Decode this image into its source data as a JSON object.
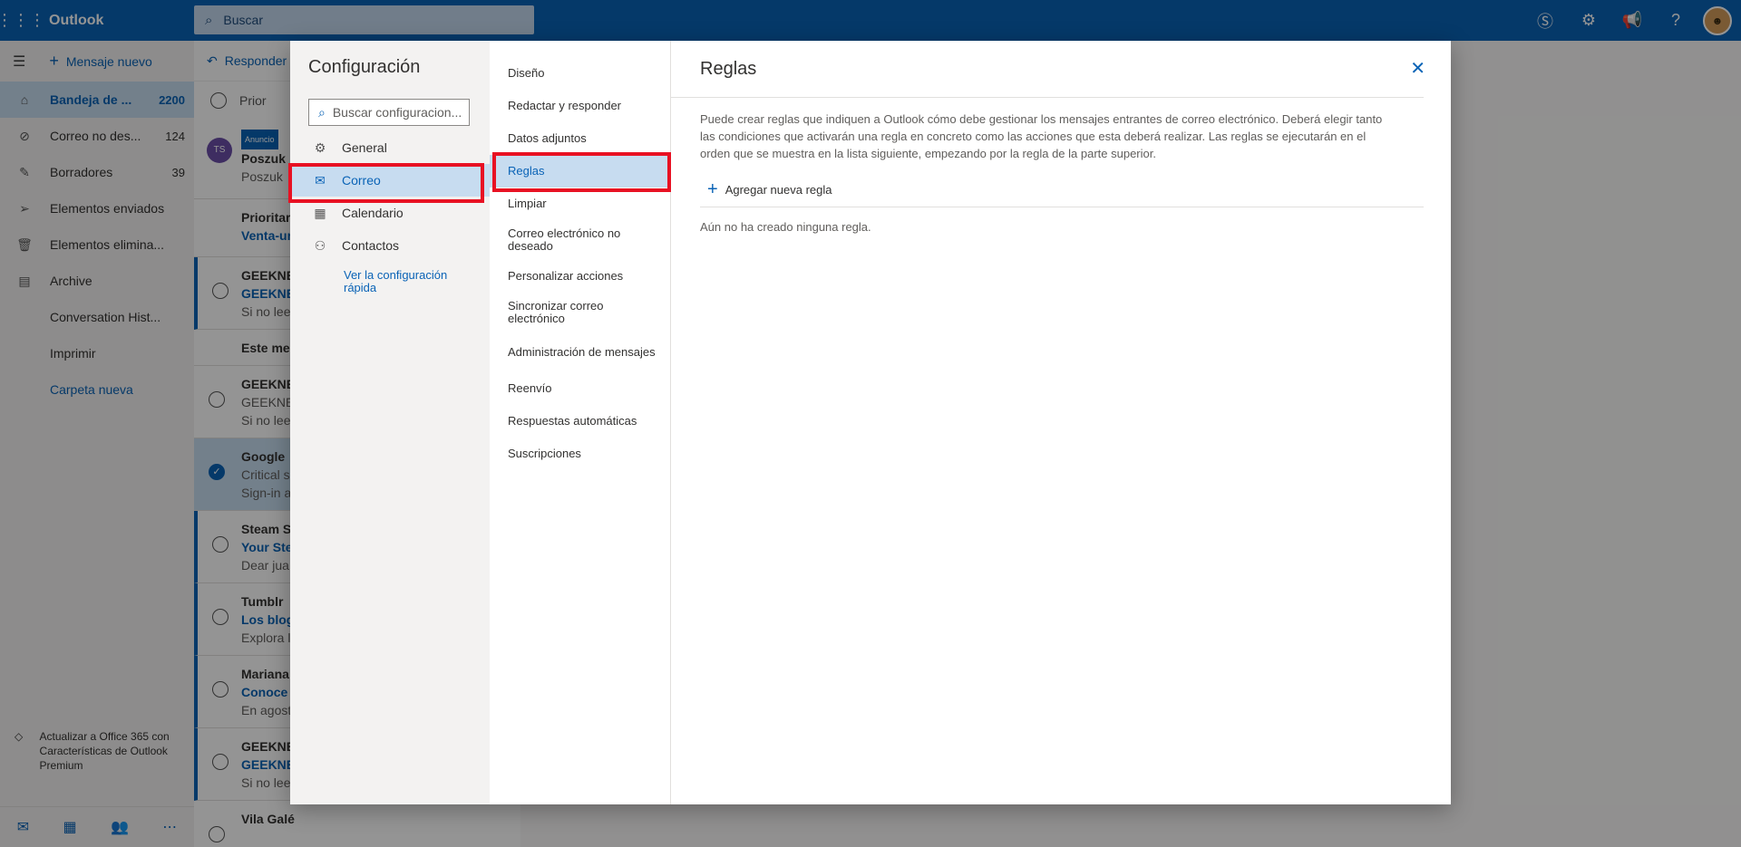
{
  "topbar": {
    "app_name": "Outlook",
    "search_placeholder": "Buscar",
    "avatar_initial": "👤"
  },
  "left_nav": {
    "new_message": "Mensaje nuevo",
    "folders": [
      {
        "label": "Bandeja de ...",
        "count": "2200",
        "icon": "inbox-icon",
        "active": true
      },
      {
        "label": "Correo no des...",
        "count": "124",
        "icon": "block-icon"
      },
      {
        "label": "Borradores",
        "count": "39",
        "icon": "pencil-icon"
      },
      {
        "label": "Elementos enviados",
        "count": "",
        "icon": "send-icon"
      },
      {
        "label": "Elementos elimina...",
        "count": "",
        "icon": "trash-icon"
      },
      {
        "label": "Archive",
        "count": "",
        "icon": "archive-icon"
      }
    ],
    "extra": [
      "Conversation Hist...",
      "Imprimir"
    ],
    "new_folder": "Carpeta nueva",
    "upgrade": "Actualizar a Office 365 con Características de Outlook Premium"
  },
  "message_list": {
    "reply": "Responder",
    "filter": "Prior",
    "ad_badge": "Anuncio",
    "ad_avatar": "TS",
    "ad_from": "Poszuk",
    "ad_preview": "Poszuk",
    "prior_from": "Prioritar",
    "prior_subj": "Venta-ur",
    "section_month": "Este mes",
    "items": [
      {
        "from": "GEEKNE",
        "subj": "GEEKNE",
        "prev": "Si no lee",
        "unread": true
      },
      {
        "from": "GEEKNE",
        "subj": "GEEKNE",
        "prev": "Si no lee",
        "unread": false
      },
      {
        "from": "Google",
        "subj": "Critical s",
        "prev": "Sign-in a",
        "selected": true
      },
      {
        "from": "Steam Su",
        "subj": "Your Stea",
        "prev": "Dear jua",
        "unread": true
      },
      {
        "from": "Tumblr",
        "subj": "Los blog",
        "prev": "Explora l",
        "unread": true
      },
      {
        "from": "Mariana",
        "subj": "Conoce",
        "prev": "En agost",
        "unread": true
      },
      {
        "from": "GEEKNE",
        "subj": "GEEKNE",
        "prev": "Si no lees correctamente este mensaje, haz cli...",
        "unread": true
      },
      {
        "from": "Vila Galé",
        "subj": "",
        "prev": "",
        "unread": false
      }
    ]
  },
  "settings": {
    "title": "Configuración",
    "search_placeholder": "Buscar configuracion...",
    "categories": [
      {
        "label": "General",
        "icon": "gear-icon"
      },
      {
        "label": "Correo",
        "icon": "mail-icon",
        "active": true
      },
      {
        "label": "Calendario",
        "icon": "calendar-icon"
      },
      {
        "label": "Contactos",
        "icon": "people-icon"
      }
    ],
    "quick_settings": "Ver la configuración rápida",
    "mail_sections": [
      "Diseño",
      "Redactar y responder",
      "Datos adjuntos",
      "Reglas",
      "Limpiar",
      "Correo electrónico no deseado",
      "Personalizar acciones",
      "Sincronizar correo electrónico",
      "Administración de mensajes",
      "Reenvío",
      "Respuestas automáticas",
      "Suscripciones"
    ],
    "active_section": "Reglas",
    "pane": {
      "heading": "Reglas",
      "description": "Puede crear reglas que indiquen a Outlook cómo debe gestionar los mensajes entrantes de correo electrónico. Deberá elegir tanto las condiciones que activarán una regla en concreto como las acciones que esta deberá realizar. Las reglas se ejecutarán en el orden que se muestra en la lista siguiente, empezando por la regla de la parte superior.",
      "add_rule": "Agregar nueva regla",
      "empty": "Aún no ha creado ninguna regla."
    }
  },
  "colors": {
    "brand": "#0a63b6",
    "highlight": "#e81123",
    "selected_bg": "#c7dcf0"
  }
}
